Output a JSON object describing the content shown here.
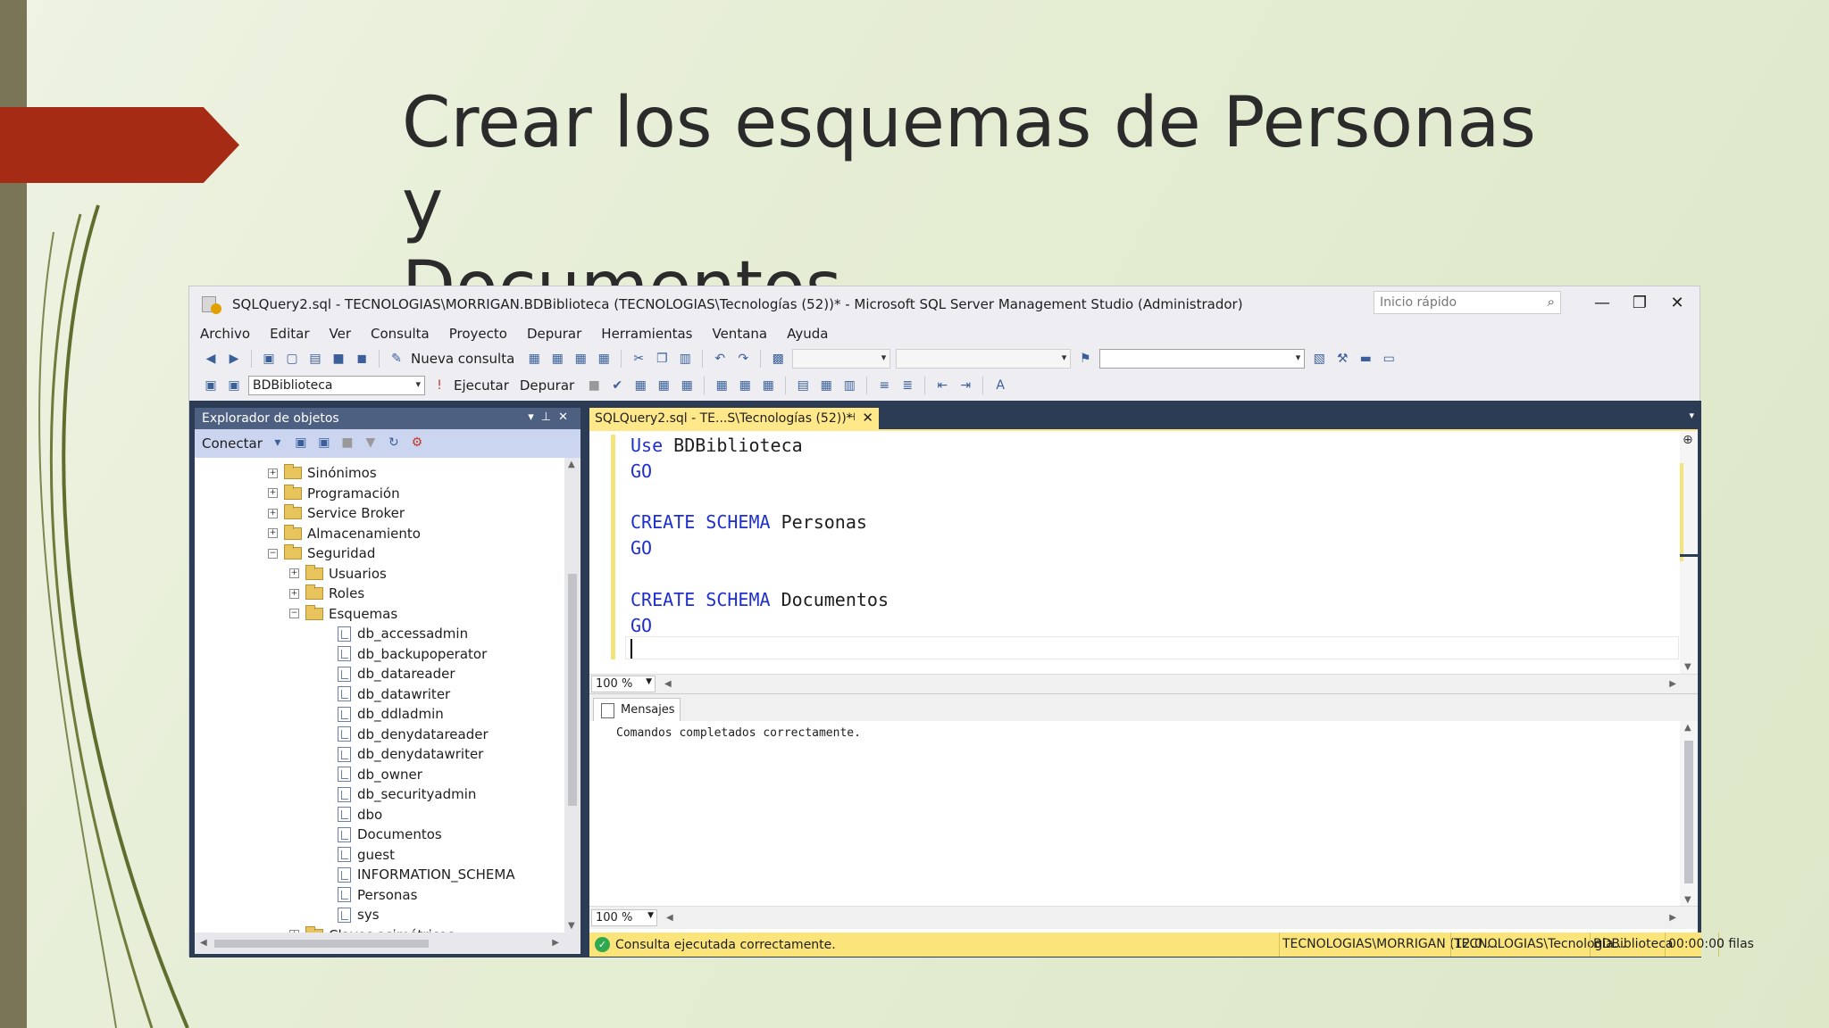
{
  "slide": {
    "title_line1": "Crear los esquemas de Personas y",
    "title_line2": "Documentos"
  },
  "window": {
    "title": "SQLQuery2.sql - TECNOLOGIAS\\MORRIGAN.BDBiblioteca (TECNOLOGIAS\\Tecnologías (52))* - Microsoft SQL Server Management Studio (Administrador)",
    "quick_launch_placeholder": "Inicio rápido",
    "minimize": "—",
    "restore": "❐",
    "close": "✕"
  },
  "menu": [
    "Archivo",
    "Editar",
    "Ver",
    "Consulta",
    "Proyecto",
    "Depurar",
    "Herramientas",
    "Ventana",
    "Ayuda"
  ],
  "toolbar": {
    "new_query": "Nueva consulta",
    "database": "BDBiblioteca",
    "execute": "Ejecutar",
    "debug": "Depurar"
  },
  "object_explorer": {
    "title": "Explorador de objetos",
    "connect": "Conectar",
    "tree": [
      {
        "label": "Sinónimos",
        "type": "folder",
        "level": 0,
        "expander": "+"
      },
      {
        "label": "Programación",
        "type": "folder",
        "level": 0,
        "expander": "+"
      },
      {
        "label": "Service Broker",
        "type": "folder",
        "level": 0,
        "expander": "+"
      },
      {
        "label": "Almacenamiento",
        "type": "folder",
        "level": 0,
        "expander": "+"
      },
      {
        "label": "Seguridad",
        "type": "folder",
        "level": 0,
        "expander": "−"
      },
      {
        "label": "Usuarios",
        "type": "folder",
        "level": 1,
        "expander": "+"
      },
      {
        "label": "Roles",
        "type": "folder",
        "level": 1,
        "expander": "+"
      },
      {
        "label": "Esquemas",
        "type": "folder",
        "level": 1,
        "expander": "−"
      },
      {
        "label": "db_accessadmin",
        "type": "schema",
        "level": 2
      },
      {
        "label": "db_backupoperator",
        "type": "schema",
        "level": 2
      },
      {
        "label": "db_datareader",
        "type": "schema",
        "level": 2
      },
      {
        "label": "db_datawriter",
        "type": "schema",
        "level": 2
      },
      {
        "label": "db_ddladmin",
        "type": "schema",
        "level": 2
      },
      {
        "label": "db_denydatareader",
        "type": "schema",
        "level": 2
      },
      {
        "label": "db_denydatawriter",
        "type": "schema",
        "level": 2
      },
      {
        "label": "db_owner",
        "type": "schema",
        "level": 2
      },
      {
        "label": "db_securityadmin",
        "type": "schema",
        "level": 2
      },
      {
        "label": "dbo",
        "type": "schema",
        "level": 2
      },
      {
        "label": "Documentos",
        "type": "schema",
        "level": 2
      },
      {
        "label": "guest",
        "type": "schema",
        "level": 2
      },
      {
        "label": "INFORMATION_SCHEMA",
        "type": "schema",
        "level": 2
      },
      {
        "label": "Personas",
        "type": "schema",
        "level": 2
      },
      {
        "label": "sys",
        "type": "schema",
        "level": 2
      },
      {
        "label": "Claves asimétricas",
        "type": "folder",
        "level": 1,
        "expander": "+"
      }
    ]
  },
  "editor": {
    "tab_label": "SQLQuery2.sql - TE...S\\Tecnologías (52))*",
    "code": [
      {
        "kw": "Use",
        "rest": " BDBiblioteca"
      },
      {
        "kw": "GO",
        "rest": ""
      },
      {
        "kw": "",
        "rest": ""
      },
      {
        "kw": "CREATE SCHEMA",
        "rest": " Personas"
      },
      {
        "kw": "GO",
        "rest": ""
      },
      {
        "kw": "",
        "rest": ""
      },
      {
        "kw": "CREATE SCHEMA",
        "rest": " Documentos"
      },
      {
        "kw": "GO",
        "rest": ""
      }
    ],
    "zoom": "100 %"
  },
  "results": {
    "tab": "Mensajes",
    "message": "Comandos completados correctamente.",
    "zoom": "100 %"
  },
  "status": {
    "message": "Consulta ejecutada correctamente.",
    "server": "TECNOLOGIAS\\MORRIGAN (12.0 ...",
    "user": "TECNOLOGIAS\\Tecnologia...",
    "database": "BDBiblioteca",
    "time": "00:00:00",
    "rows": "0 filas"
  },
  "colors": {
    "accent_red": "#a62b14",
    "editor_tab": "#ffe88a",
    "status_bar": "#fbe57a",
    "keyword": "#1f2fcf"
  }
}
